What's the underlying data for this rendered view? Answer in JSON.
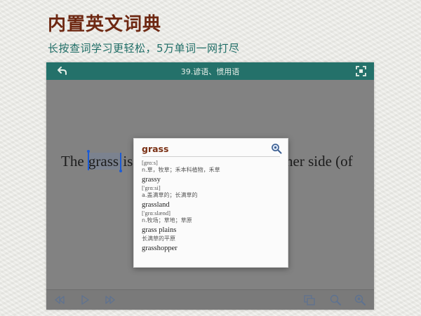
{
  "promo": {
    "title": "内置英文词典",
    "subtitle": "长按查词学习更轻松，5万单词一网打尽"
  },
  "topbar": {
    "title": "39.谚语、惯用语",
    "back_icon": "back-arrow-icon",
    "fullscreen_icon": "fullscreen-icon",
    "color": "#24716a"
  },
  "reading": {
    "text_before": "The ",
    "selected_word": "grass",
    "text_after_visible": " is",
    "text_right_visible": "her side (of"
  },
  "dictionary": {
    "query": "grass",
    "search_icon": "search-icon",
    "entries": [
      {
        "headword": "",
        "phonetic": "[grɑːs]",
        "definition": "n.草，牧草；禾本科植物，禾草"
      },
      {
        "headword": "grassy",
        "phonetic": "['grɑːsi]",
        "definition": "a.盖满草的；长满草的"
      },
      {
        "headword": "grassland",
        "phonetic": "['grɑːslænd]",
        "definition": "n.牧场；草地；草原"
      },
      {
        "headword": "grass plains",
        "phonetic": "",
        "definition": "长满草的平原"
      },
      {
        "headword": "grasshopper",
        "phonetic": "",
        "definition": ""
      }
    ]
  },
  "bottombar": {
    "icons": [
      "rewind-icon",
      "play-icon",
      "fast-forward-icon",
      "copy-icon",
      "zoom-icon",
      "settings-icon"
    ]
  }
}
